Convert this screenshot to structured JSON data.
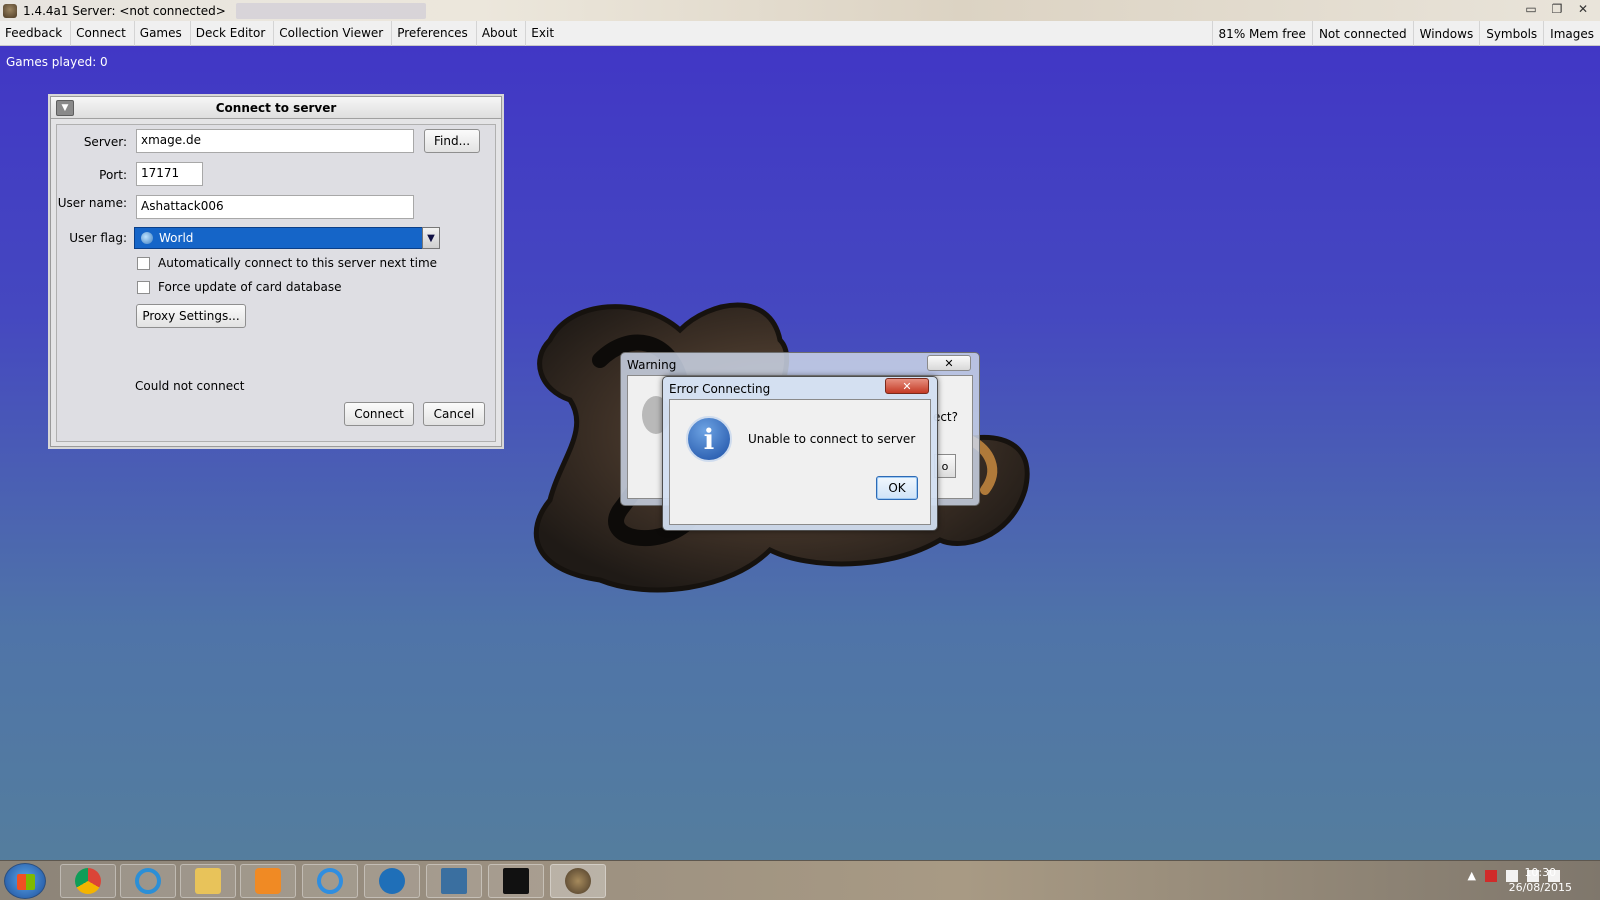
{
  "window": {
    "title": "1.4.4a1  Server: <not connected>",
    "controls": [
      "▭",
      "❐",
      "✕"
    ]
  },
  "menubar": {
    "left": [
      "Feedback",
      "Connect",
      "Games",
      "Deck Editor",
      "Collection Viewer",
      "Preferences",
      "About",
      "Exit"
    ],
    "right": [
      "81% Mem free",
      "Not connected",
      "Windows",
      "Symbols",
      "Images"
    ]
  },
  "games_played": "Games played: 0",
  "connect_dialog": {
    "title": "Connect to server",
    "server_label": "Server:",
    "server_value": "xmage.de",
    "find_button": "Find...",
    "port_label": "Port:",
    "port_value": "17171",
    "username_label": "User name:",
    "username_value": "Ashattack006",
    "userflag_label": "User flag:",
    "userflag_value": "World",
    "auto_connect_label": "Automatically connect to this server next time",
    "force_update_label": "Force update of card database",
    "proxy_button": "Proxy Settings...",
    "status": "Could not connect",
    "connect_button": "Connect",
    "cancel_button": "Cancel"
  },
  "warning_dialog": {
    "title": "Warning",
    "close": "✕",
    "partial_text": "ect?",
    "partial_button": "o"
  },
  "error_dialog": {
    "title": "Error Connecting",
    "close": "✕",
    "icon": "i",
    "message": "Unable to connect to server",
    "ok_button": "OK"
  },
  "taskbar": {
    "apps": [
      "chrome-icon",
      "sync-icon",
      "folder-icon",
      "media-player-icon",
      "ie-icon",
      "dell-icon",
      "computer-icon",
      "cmd-icon",
      "xmage-icon"
    ],
    "clock_time": "10:30",
    "clock_date": "26/08/2015"
  }
}
